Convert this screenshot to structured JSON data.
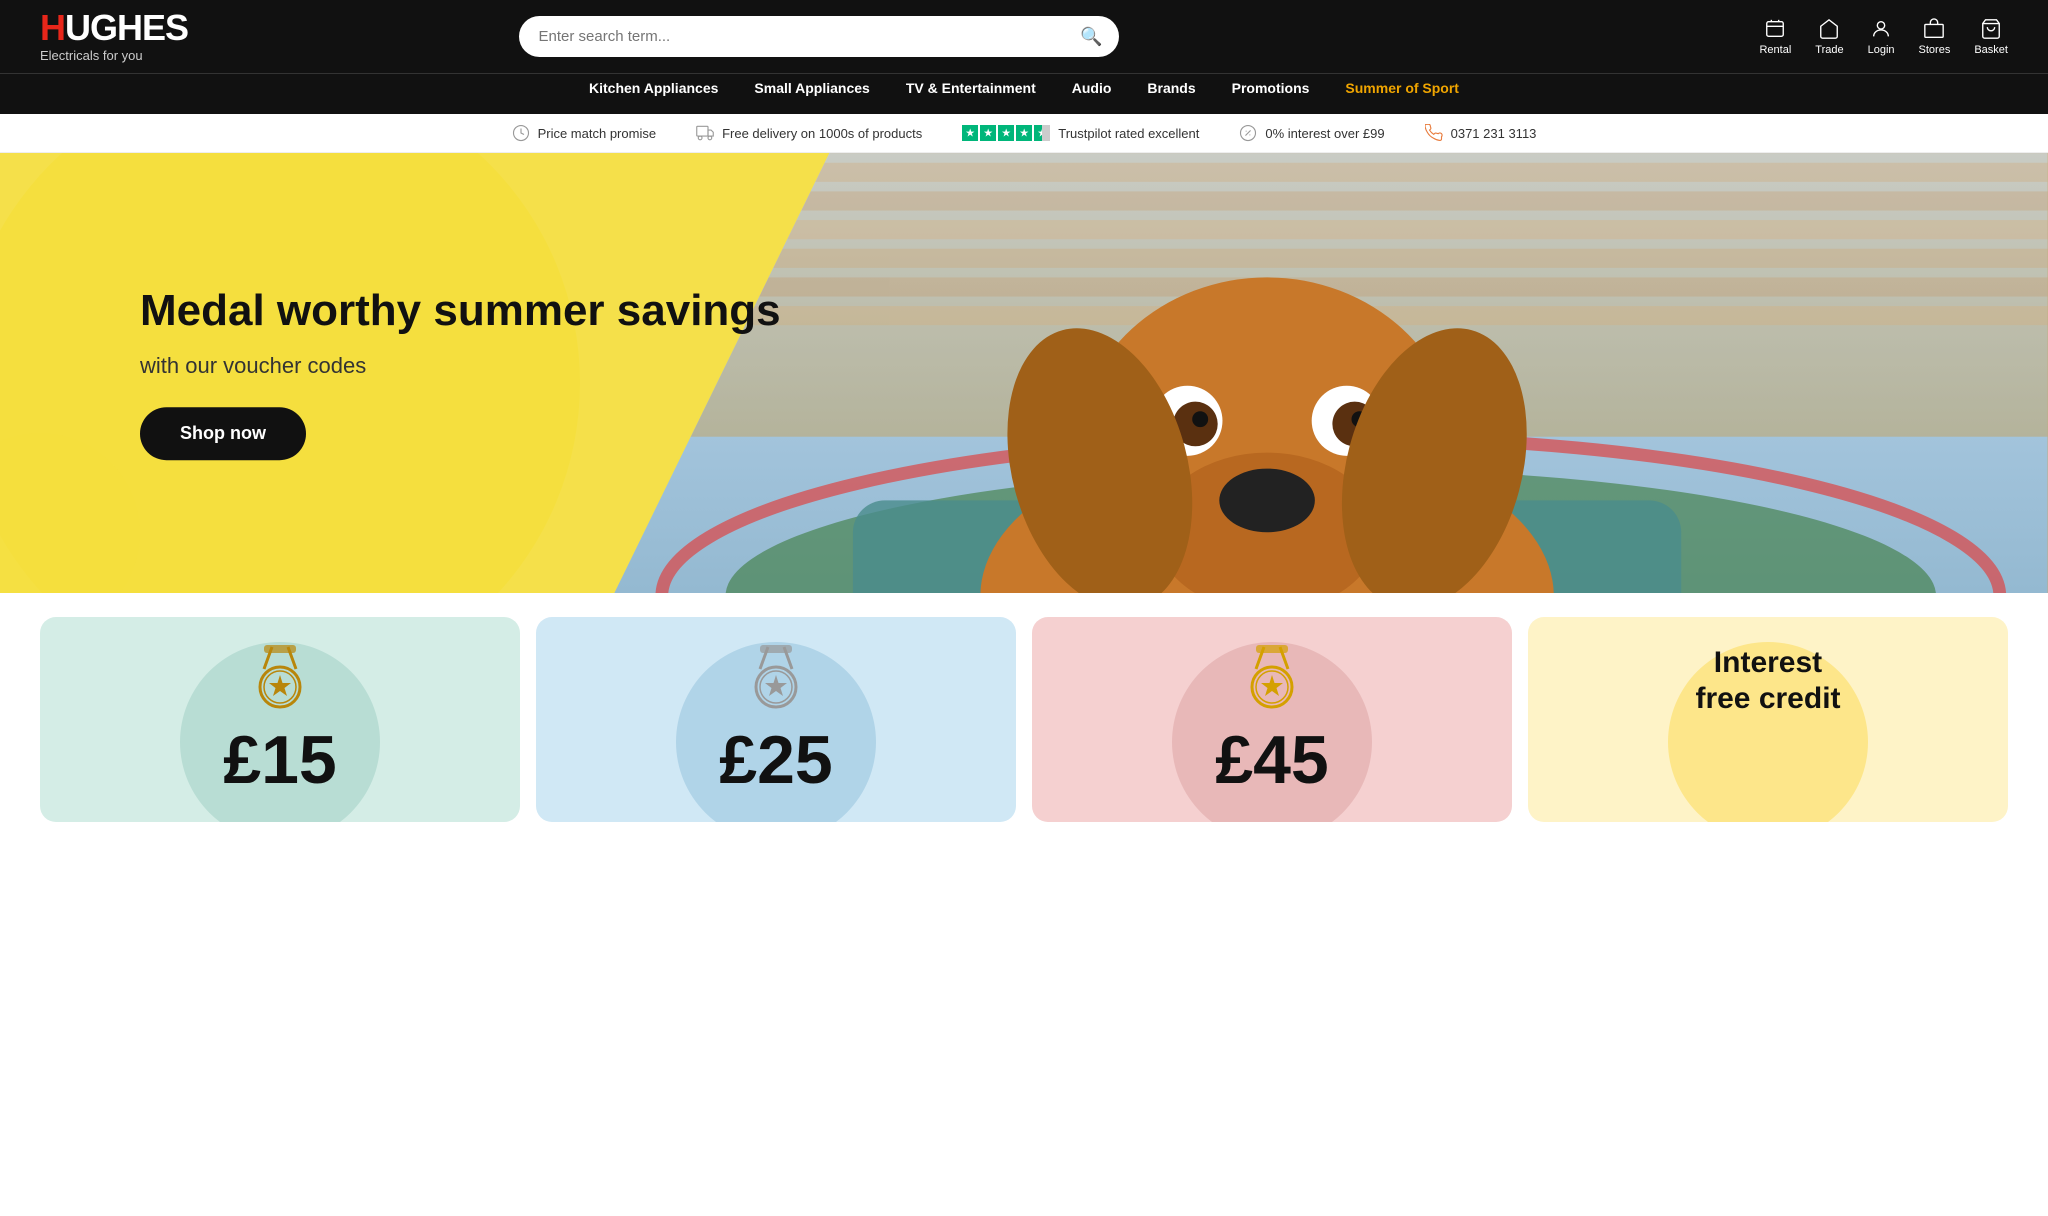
{
  "logo": {
    "brand": "HUGHES",
    "tagline": "Electricals for you"
  },
  "search": {
    "placeholder": "Enter search term..."
  },
  "header_icons": [
    {
      "id": "rental",
      "label": "Rental"
    },
    {
      "id": "trade",
      "label": "Trade"
    },
    {
      "id": "login",
      "label": "Login"
    },
    {
      "id": "stores",
      "label": "Stores"
    },
    {
      "id": "basket",
      "label": "Basket"
    }
  ],
  "nav": {
    "items": [
      {
        "id": "kitchen",
        "label": "Kitchen Appliances",
        "class": ""
      },
      {
        "id": "small",
        "label": "Small Appliances",
        "class": ""
      },
      {
        "id": "tv",
        "label": "TV & Entertainment",
        "class": ""
      },
      {
        "id": "audio",
        "label": "Audio",
        "class": ""
      },
      {
        "id": "brands",
        "label": "Brands",
        "class": ""
      },
      {
        "id": "promotions",
        "label": "Promotions",
        "class": ""
      },
      {
        "id": "summer",
        "label": "Summer of Sport",
        "class": "summer"
      }
    ]
  },
  "trust_bar": {
    "items": [
      {
        "id": "price-match",
        "text": "Price match promise"
      },
      {
        "id": "free-delivery",
        "text": "Free delivery on 1000s of products"
      },
      {
        "id": "trustpilot",
        "text": "Trustpilot rated excellent"
      },
      {
        "id": "interest",
        "text": "0% interest over £99"
      },
      {
        "id": "phone",
        "text": "0371 231 3113"
      }
    ]
  },
  "hero": {
    "title": "Medal worthy summer savings",
    "subtitle": "with our voucher codes",
    "cta_label": "Shop now"
  },
  "promo_cards": [
    {
      "id": "card-15",
      "amount": "£15",
      "color": "green",
      "medal_color": "#b8860b"
    },
    {
      "id": "card-25",
      "amount": "£25",
      "color": "blue",
      "medal_color": "#999"
    },
    {
      "id": "card-45",
      "amount": "£45",
      "color": "pink",
      "medal_color": "#d4a000"
    },
    {
      "id": "card-credit",
      "text": "Interest free credit",
      "color": "yellow"
    }
  ]
}
